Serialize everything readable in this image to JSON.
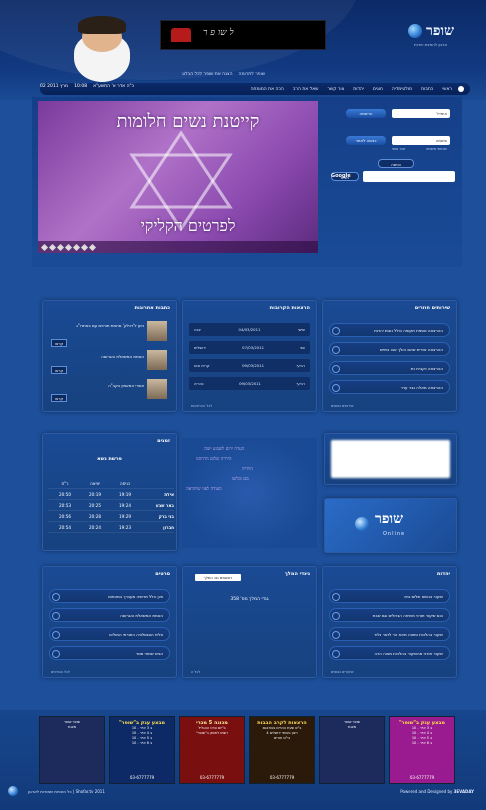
{
  "header": {
    "logo_name": "שופר",
    "logo_tagline": "ארגון להפצת יהדות",
    "banner_text": "ל שו פ ר",
    "toplinks": [
      "שופר לתרומה",
      "הצגה את שופר לכל הבלוג"
    ],
    "date_gregorian": "02 מרץ 2011",
    "time": "10:08",
    "date_hebrew": "כ\"ה אדר א' התשע\"א"
  },
  "nav": {
    "items": [
      "ראשי",
      "כתבות",
      "מולטימדיה",
      "חוגים",
      "יהדות",
      "צור קשר",
      "שאל את הרב",
      "הכה את המומחה"
    ]
  },
  "login": {
    "email_placeholder": "אימייל",
    "email_button": "הרשמה",
    "password_placeholder": "סיסמה",
    "password_button": "כניסה לאתר",
    "remember_label": "זכור אותי",
    "forgot_label": "שכחתי סיסמה",
    "submit": "כניסה",
    "search_button": "חפש",
    "google_label": "Google"
  },
  "hero": {
    "title": "קייטנת נשים חלומות",
    "subtitle": "לפרטים הקליקי"
  },
  "panels": {
    "services": {
      "title": "שירותים חוזרים",
      "rows": [
        "ההרצאה נוספת תקופה כולל נוגות יהדות",
        "ההרצאה אזרית שהם הולך אבו בתיים",
        "ההרצאה נקבית נת",
        "ההרצאה מאלה גבר עדר"
      ],
      "more": "שירותים נוספים"
    },
    "lectures": {
      "title": "הרצאות הקרובות",
      "rows": [
        {
          "day": "שישי",
          "date": "04/03/2011",
          "city": "יבנה"
        },
        {
          "day": "שני",
          "date": "07/03/2011",
          "city": "ירושלים"
        },
        {
          "day": "רביעי",
          "date": "09/03/2011",
          "city": "קרית אונו"
        },
        {
          "day": "רביעי",
          "date": "09/03/2011",
          "city": "נהריה"
        }
      ],
      "more": "לכל ההרצאות"
    },
    "articles": {
      "title": "כתבות אחרונות",
      "items": [
        "ניוע ל'דכלק' מחמת תורנים עם באתרו\"ג",
        "האמת המשאלת והגרוסה",
        "אשרי המאמין בקב\"ה"
      ],
      "read_label": "קראו"
    },
    "zmanim": {
      "title": "זמנים",
      "parasha": "פרשת נשא",
      "headers": [
        "כניסה",
        "יציאה",
        "ר\"ת"
      ],
      "rows": [
        {
          "city": "אילת",
          "in": "19:19",
          "out": "20:19",
          "rt": "20:50"
        },
        {
          "city": "באר שבע",
          "in": "19:24",
          "out": "20:25",
          "rt": "20:53"
        },
        {
          "city": "בני ברק",
          "in": "19:29",
          "out": "20:28",
          "rt": "20:56"
        },
        {
          "city": "חברון",
          "in": "19:23",
          "out": "20:24",
          "rt": "20:54"
        }
      ]
    },
    "middle_watermark": [
      "הערה ירום לשבוע יומה",
      "היררה שלום הדהחנו",
      "הוידיה",
      "מם וכלשו",
      "העודה לפני שיתראה"
    ],
    "online": {
      "name": "שופר",
      "sub": "Online"
    },
    "judaism": {
      "title": "יהדות",
      "rows": [
        "שיעור בנושא שלום בית",
        "כנס שיעור תורני משיחה הגדולים וגם שבת",
        "שיעור בהלכות ומצוה מאת הר לזאר נלוד",
        "שיעור תורני מהשיעור בהלכות מצוה הרב"
      ],
      "more": "שיעורים נוספים"
    },
    "siddur": {
      "title": "גינדי המלך",
      "select": "ראשתם גננ המלך",
      "text": "גנדי המלך מס' 358",
      "more": "לכל ה"
    },
    "clips": {
      "title": "סרטים",
      "rows": [
        "ציון הלל מרשיה מעברך במטחום",
        "האמת המשאלת והגרוסה",
        "צליח הסנסלוויה התורתי המולאו",
        "הגיש שמחי מסר"
      ],
      "more": "לכל הסרטים"
    }
  },
  "ads": [
    {
      "title": "מבצע ענק ב\"שופר\"",
      "lines": [
        "ב 3 אייר - 10",
        "ב 4 אייר - 10",
        "ב 5 אייר - 10",
        "ב 6 אייר - 10"
      ],
      "phone": "03-6777779",
      "bg": "#9a1b8f",
      "tc": "#ffe14a"
    },
    {
      "title": "",
      "lines": [
        "שופר שופר",
        "מצגת"
      ],
      "phone": "",
      "bg": "#1c2a5c",
      "tc": "#ffffff"
    },
    {
      "title": "הרצאות לקרב הבבות",
      "lines": [
        "ב\"ש שעת ההרים גשורבגם",
        "רצון כשותי ירושלים 4",
        "בי\"ס חורים"
      ],
      "phone": "03-6777779",
      "bg": "#2b1a0a",
      "tc": "#ffd95a"
    },
    {
      "title": "מכונה 5 מכרי",
      "lines": [
        "ב\"יום סרט ההגליל",
        "רשמו לתשק ב\"שופר\""
      ],
      "phone": "03-6777779",
      "bg": "#7a0f0f",
      "tc": "#fff3a0"
    },
    {
      "title": "מבצע ענק ב\"שופר\"",
      "lines": [
        "ב 3 אייר - 10",
        "ב 4 אייר - 10",
        "ב 5 אייר - 10",
        "ב 6 אייר - 10"
      ],
      "phone": "03-6777779",
      "bg": "#0e2a66",
      "tc": "#ffe14a"
    },
    {
      "title": "",
      "lines": [
        "שופר שופר",
        "מצגת"
      ],
      "phone": "",
      "bg": "#1c2a5c",
      "tc": "#ffffff"
    }
  ],
  "footer": {
    "right_text": "Powered and Designed by",
    "brand": "3EVADAY",
    "left_text": "כל הזכויות שמורות לארגון | Shofar.tv 2011"
  },
  "colors": {
    "page_bg": "#1d4f9a",
    "header_bg": "#0c2a66",
    "hero_purple": "#8c4bb0",
    "row_border": "#2b5fb2"
  }
}
